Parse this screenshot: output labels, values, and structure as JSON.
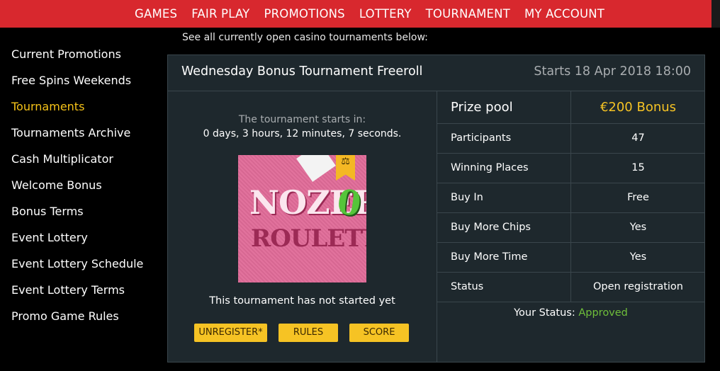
{
  "nav": {
    "items": [
      "GAMES",
      "FAIR PLAY",
      "PROMOTIONS",
      "LOTTERY",
      "TOURNAMENT",
      "MY ACCOUNT"
    ]
  },
  "sidebar": {
    "items": [
      {
        "label": "Current Promotions",
        "active": false
      },
      {
        "label": "Free Spins Weekends",
        "active": false
      },
      {
        "label": "Tournaments",
        "active": true
      },
      {
        "label": "Tournaments Archive",
        "active": false
      },
      {
        "label": "Cash Multiplicator",
        "active": false
      },
      {
        "label": "Welcome Bonus",
        "active": false
      },
      {
        "label": "Bonus Terms",
        "active": false
      },
      {
        "label": "Event Lottery",
        "active": false
      },
      {
        "label": "Event Lottery Schedule",
        "active": false
      },
      {
        "label": "Event Lottery Terms",
        "active": false
      },
      {
        "label": "Promo Game Rules",
        "active": false
      }
    ]
  },
  "intro": "See all currently open casino tournaments below:",
  "tournament": {
    "title": "Wednesday Bonus Tournament Freeroll",
    "starts": "Starts 18 Apr 2018 18:00",
    "countdown_label": "The tournament starts in:",
    "countdown_value": "0 days, 3 hours, 12 minutes, 7 seconds.",
    "game": {
      "title_line1": "NOZER",
      "title_zero": "0",
      "title_line2": "ROULETTE",
      "badge_icon": "scales-icon"
    },
    "not_started": "This tournament has not started yet",
    "buttons": {
      "unregister": "UNREGISTER*",
      "rules": "RULES",
      "score": "SCORE"
    },
    "prize_label": "Prize pool",
    "prize_value": "€200 Bonus",
    "rows": [
      {
        "key": "Participants",
        "value": "47"
      },
      {
        "key": "Winning Places",
        "value": "15"
      },
      {
        "key": "Buy In",
        "value": "Free"
      },
      {
        "key": "Buy More Chips",
        "value": "Yes"
      },
      {
        "key": "Buy More Time",
        "value": "Yes"
      },
      {
        "key": "Status",
        "value": "Open registration"
      }
    ],
    "your_status_label": "Your Status:",
    "your_status_value": "Approved"
  },
  "colors": {
    "nav_bg": "#d8282e",
    "accent": "#f6c324",
    "panel_bg": "#1e282d",
    "approved": "#6fbf3a"
  }
}
